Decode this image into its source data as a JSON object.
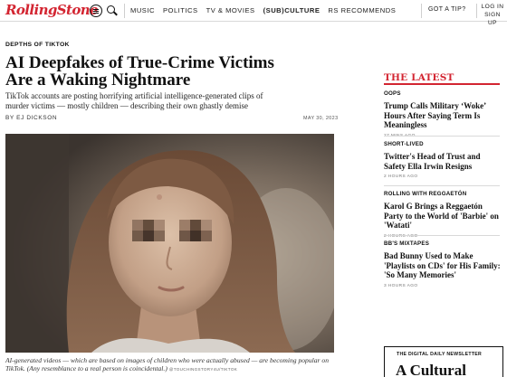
{
  "header": {
    "logo": "RollingStone",
    "nav": [
      "MUSIC",
      "POLITICS",
      "TV & MOVIES",
      "(SUB)CULTURE",
      "RS RECOMMENDS"
    ],
    "tip": "GOT A TIP?",
    "login": "LOG IN",
    "signup": "SIGN UP"
  },
  "article": {
    "kicker": "DEPTHS OF TIKTOK",
    "headline": "AI Deepfakes of True-Crime Victims Are a Waking Nightmare",
    "dek": "TikTok accounts are posting horrifying artificial intelligence-generated clips of murder victims — mostly children — describing their own ghastly demise",
    "byline": "BY EJ DICKSON",
    "date": "MAY 30, 2023",
    "caption": "AI-generated videos — which are based on images of children who were actually abused — are becoming popular on TikTok. (Any resemblance to a real person is coincidental.)",
    "credit": "@TOUCHINGSTORY4U/TIKTOK"
  },
  "sidebar": {
    "title": "THE LATEST",
    "stories": [
      {
        "category": "OOPS",
        "title": "Trump Calls Military ‘Woke’ Hours After Saying Term Is Meaningless",
        "time": "27 MINS AGO"
      },
      {
        "category": "SHORT-LIVED",
        "title": "Twitter's Head of Trust and Safety Ella Irwin Resigns",
        "time": "2 HOURS AGO"
      },
      {
        "category": "ROLLING WITH REGGAETÓN",
        "title": "Karol G Brings a Reggaetón Party to the World of 'Barbie' on 'Watati'",
        "time": "2 HOURS AGO"
      },
      {
        "category": "BB'S MIXTAPES",
        "title": "Bad Bunny Used to Make 'Playlists on CDs' for His Family: 'So Many Memories'",
        "time": "3 HOURS AGO"
      }
    ],
    "promo_label": "THE DIGITAL DAILY NEWSLETTER",
    "promo_title": "A Cultural"
  }
}
